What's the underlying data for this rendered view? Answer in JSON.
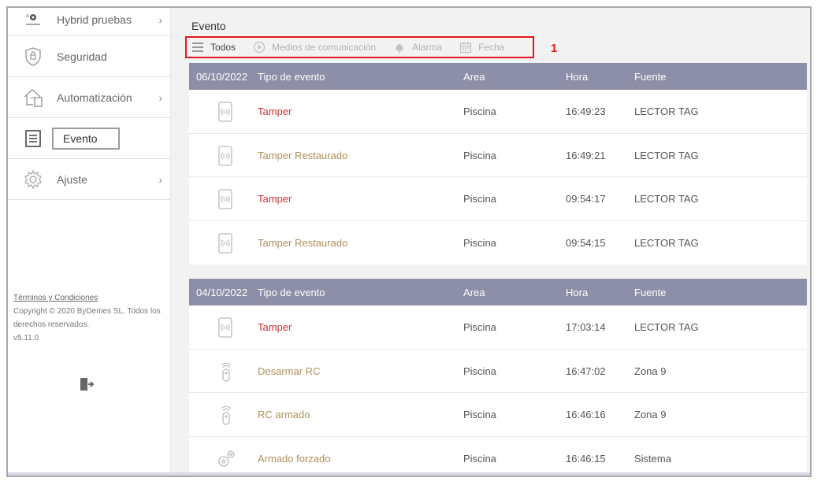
{
  "sidebar": {
    "items": [
      {
        "label": "Hybrid pruebas",
        "icon": "site-icon",
        "chevron": "›"
      },
      {
        "label": "Seguridad",
        "icon": "shield-icon",
        "chevron": ""
      },
      {
        "label": "Automatización",
        "icon": "home-automation-icon",
        "chevron": "›"
      },
      {
        "label": "Evento",
        "icon": "event-list-icon",
        "chevron": ""
      },
      {
        "label": "Ajuste",
        "icon": "gear-icon",
        "chevron": "›"
      }
    ],
    "footer": {
      "terms": "Términos y Condiciones",
      "copyright": "Copyright © 2020 ByDemes SL. Todos los derechos reservados.",
      "version": "v5.11.0"
    }
  },
  "main": {
    "title": "Evento",
    "filters": [
      {
        "label": "Todos",
        "icon": "menu-icon"
      },
      {
        "label": "Medios de comunicación",
        "icon": "play-circle-icon"
      },
      {
        "label": "Alarma",
        "icon": "bell-icon"
      },
      {
        "label": "Fecha",
        "icon": "calendar-icon"
      }
    ],
    "marker": "1",
    "columns": {
      "type": "Tipo de evento",
      "area": "Area",
      "hora": "Hora",
      "fuente": "Fuente"
    },
    "groups": [
      {
        "date": "06/10/2022",
        "rows": [
          {
            "type": "Tamper",
            "area": "Piscina",
            "hora": "16:49:23",
            "fuente": "LECTOR TAG",
            "color": "#d6302f",
            "icon": "tag-reader-icon"
          },
          {
            "type": "Tamper Restaurado",
            "area": "Piscina",
            "hora": "16:49:21",
            "fuente": "LECTOR TAG",
            "color": "#b08f5b",
            "icon": "tag-reader-icon"
          },
          {
            "type": "Tamper",
            "area": "Piscina",
            "hora": "09:54:17",
            "fuente": "LECTOR TAG",
            "color": "#d6302f",
            "icon": "tag-reader-icon"
          },
          {
            "type": "Tamper Restaurado",
            "area": "Piscina",
            "hora": "09:54:15",
            "fuente": "LECTOR TAG",
            "color": "#b08f5b",
            "icon": "tag-reader-icon"
          }
        ]
      },
      {
        "date": "04/10/2022",
        "rows": [
          {
            "type": "Tamper",
            "area": "Piscina",
            "hora": "17:03:14",
            "fuente": "LECTOR TAG",
            "color": "#d6302f",
            "icon": "tag-reader-icon"
          },
          {
            "type": "Desarmar RC",
            "area": "Piscina",
            "hora": "16:47:02",
            "fuente": "Zona 9",
            "color": "#b08f5b",
            "icon": "remote-control-icon"
          },
          {
            "type": "RC armado",
            "area": "Piscina",
            "hora": "16:46:16",
            "fuente": "Zona 9",
            "color": "#b08f5b",
            "icon": "remote-control-icon"
          },
          {
            "type": "Armado forzado",
            "area": "Piscina",
            "hora": "16:46:15",
            "fuente": "Sistema",
            "color": "#b08f5b",
            "icon": "system-gears-icon"
          }
        ]
      }
    ]
  },
  "colors": {
    "header": "#8d8ea7",
    "alarm": "#d6302f",
    "restore": "#b08f5b",
    "highlight": "#e8151b"
  }
}
